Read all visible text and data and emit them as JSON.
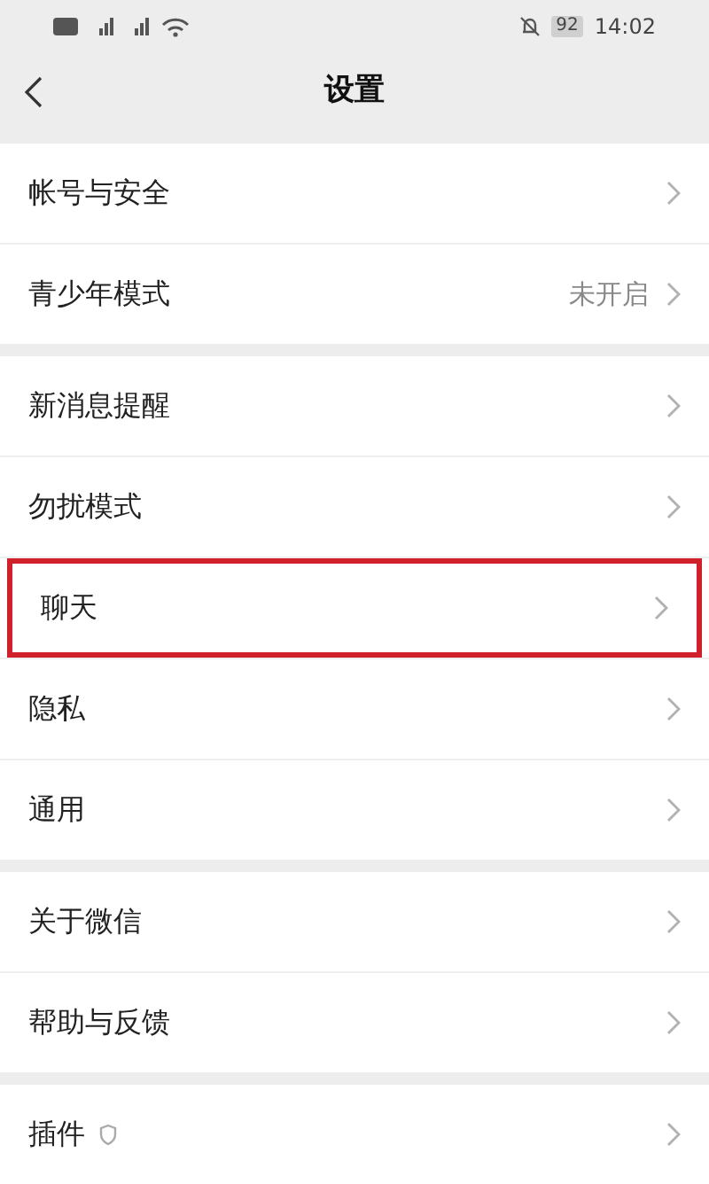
{
  "status_bar": {
    "battery": "92",
    "time": "14:02"
  },
  "header": {
    "title": "设置"
  },
  "groups": [
    {
      "items": [
        {
          "label": "帐号与安全",
          "highlighted": false
        },
        {
          "label": "青少年模式",
          "value": "未开启",
          "highlighted": false
        }
      ]
    },
    {
      "items": [
        {
          "label": "新消息提醒",
          "highlighted": false
        },
        {
          "label": "勿扰模式",
          "highlighted": false
        },
        {
          "label": "聊天",
          "highlighted": true
        },
        {
          "label": "隐私",
          "highlighted": false
        },
        {
          "label": "通用",
          "highlighted": false
        }
      ]
    },
    {
      "items": [
        {
          "label": "关于微信",
          "highlighted": false
        },
        {
          "label": "帮助与反馈",
          "highlighted": false
        }
      ]
    },
    {
      "items": [
        {
          "label": "插件",
          "shield_mark": true,
          "highlighted": false
        }
      ]
    }
  ]
}
